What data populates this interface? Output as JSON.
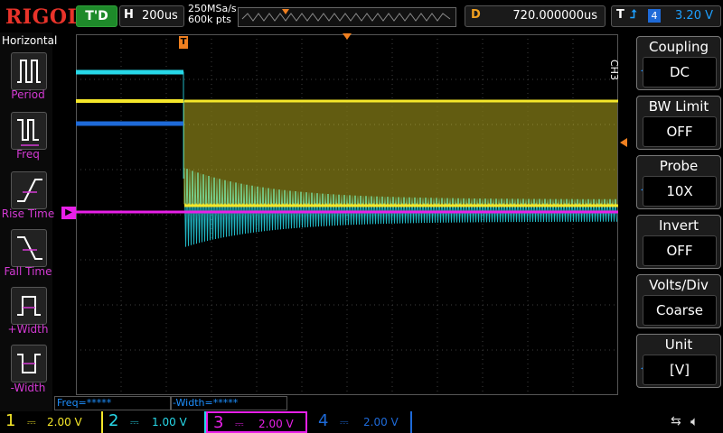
{
  "top": {
    "logo": "RIGOL",
    "run_status": "T'D",
    "h_label": "H",
    "timebase": "200us",
    "sample_rate": "250MSa/s",
    "mem_depth": "600k pts",
    "d_label": "D",
    "delay": "720.000000us",
    "trig_label": "T",
    "trig_channel": "4",
    "trig_level": "3.20 V"
  },
  "left_menu": {
    "title": "Horizontal",
    "items": [
      "Period",
      "Freq",
      "Rise Time",
      "Fall Time",
      "+Width",
      "-Width"
    ]
  },
  "right_menu": {
    "channel_label": "CH3",
    "items": [
      {
        "title": "Coupling",
        "value": "DC"
      },
      {
        "title": "BW Limit",
        "value": "OFF"
      },
      {
        "title": "Probe",
        "value": "10X"
      },
      {
        "title": "Invert",
        "value": "OFF"
      },
      {
        "title": "Volts/Div",
        "value": "Coarse"
      },
      {
        "title": "Unit",
        "value": "[V]"
      }
    ]
  },
  "measurements": {
    "freq": "Freq=*****",
    "width": "-Width=*****"
  },
  "channels": [
    {
      "num": "1",
      "scale": "2.00 V",
      "color": "#f5e72a"
    },
    {
      "num": "2",
      "scale": "1.00 V",
      "color": "#27d8e8"
    },
    {
      "num": "3",
      "scale": "2.00 V",
      "color": "#e820e8"
    },
    {
      "num": "4",
      "scale": "2.00 V",
      "color": "#1e6ad8"
    }
  ],
  "colors": {
    "ch1": "#f5e72a",
    "ch2": "#27d8e8",
    "ch3": "#e820e8",
    "ch4": "#1e6ad8",
    "trigger_marker": "#f08020",
    "grid": "#4a4a4a"
  }
}
